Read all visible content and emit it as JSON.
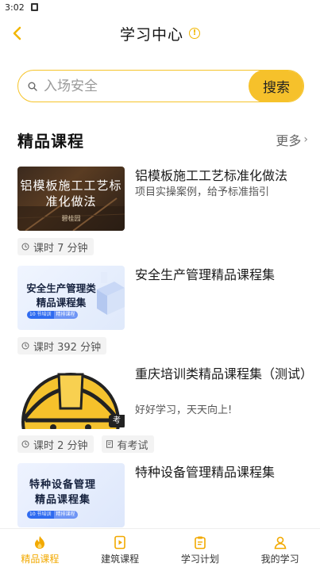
{
  "status_bar": {
    "time": "3:02"
  },
  "nav": {
    "title": "学习中心"
  },
  "search": {
    "placeholder": "入场安全",
    "button_label": "搜索"
  },
  "section": {
    "title": "精品课程",
    "more_label": "更多"
  },
  "courses": [
    {
      "title": "铝模板施工工艺标准化做法",
      "subtitle": "项目实操案例，给予标准指引",
      "thumb_text": "铝模板施工工艺标准化做法",
      "thumb_caption": "碧桂园",
      "tags": [
        "课时 7 分钟"
      ]
    },
    {
      "title": "安全生产管理精品课程集",
      "subtitle": "",
      "thumb_text": "安全生产管理类精品课程集",
      "thumb_pill": [
        "10 节培训",
        "精排课程"
      ],
      "tags": [
        "课时 392 分钟"
      ]
    },
    {
      "title": "重庆培训类精品课程集（测试）",
      "subtitle": "好好学习，天天向上!",
      "thumb_badge": "考",
      "tags": [
        "课时 2 分钟",
        "有考试"
      ]
    },
    {
      "title": "特种设备管理精品课程集",
      "subtitle": "",
      "thumb_text": "特种设备管理精品课程集",
      "thumb_pill": [
        "10 节培训",
        "精排课程"
      ],
      "tags": []
    }
  ],
  "tabbar": {
    "items": [
      {
        "label": "精品课程",
        "icon": "flame-icon",
        "active": true
      },
      {
        "label": "建筑课程",
        "icon": "document-play-icon",
        "active": false
      },
      {
        "label": "学习计划",
        "icon": "clipboard-icon",
        "active": false
      },
      {
        "label": "我的学习",
        "icon": "user-icon",
        "active": false
      }
    ]
  },
  "colors": {
    "accent": "#f6c12b",
    "active_tab": "#f2a900"
  }
}
